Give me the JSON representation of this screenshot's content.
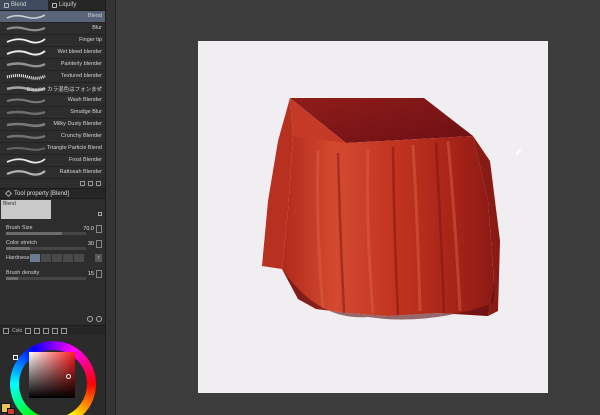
{
  "app": {
    "accent": "#596478",
    "canvas_bg": "#3c3c3c",
    "paper_color": "#f0eef0",
    "cloth_color": "#c73a2a"
  },
  "tabs": [
    {
      "label": "Blend",
      "icon": "blend-tool-icon",
      "active": true
    },
    {
      "label": "Liquify",
      "icon": "liquify-tool-icon",
      "active": false
    }
  ],
  "brushes": [
    {
      "label": "Blend",
      "selected": true
    },
    {
      "label": "Blur"
    },
    {
      "label": "Finger tip"
    },
    {
      "label": "Wet bleed blender"
    },
    {
      "label": "Painterly blender"
    },
    {
      "label": "Textured blender"
    },
    {
      "label": "Blender カラ混色はフォンまぜ"
    },
    {
      "label": "Wash Blender"
    },
    {
      "label": "Smudge Blur"
    },
    {
      "label": "Milky Dusty Blender"
    },
    {
      "label": "Crunchy Blender"
    },
    {
      "label": "Triangle Particle Blend"
    },
    {
      "label": "Frost Blender"
    },
    {
      "label": "Rattosah Blender"
    }
  ],
  "tool_property": {
    "title": "Tool property [Blend]",
    "preset_label": "Blend",
    "brush_size": {
      "label": "Brush Size",
      "value": "70.0",
      "fraction": 0.7
    },
    "color_stretch": {
      "label": "Color stretch",
      "value": "30",
      "fraction": 0.3
    },
    "hardness": {
      "label": "Hardness",
      "level": 1,
      "of": 5
    },
    "brush_density": {
      "label": "Brush density",
      "value": "15",
      "fraction": 0.15
    }
  },
  "color_panel": {
    "title": "Colo",
    "hue": "#ff1a1a",
    "foreground": "#e8c25b",
    "background": "#d23a2a"
  }
}
